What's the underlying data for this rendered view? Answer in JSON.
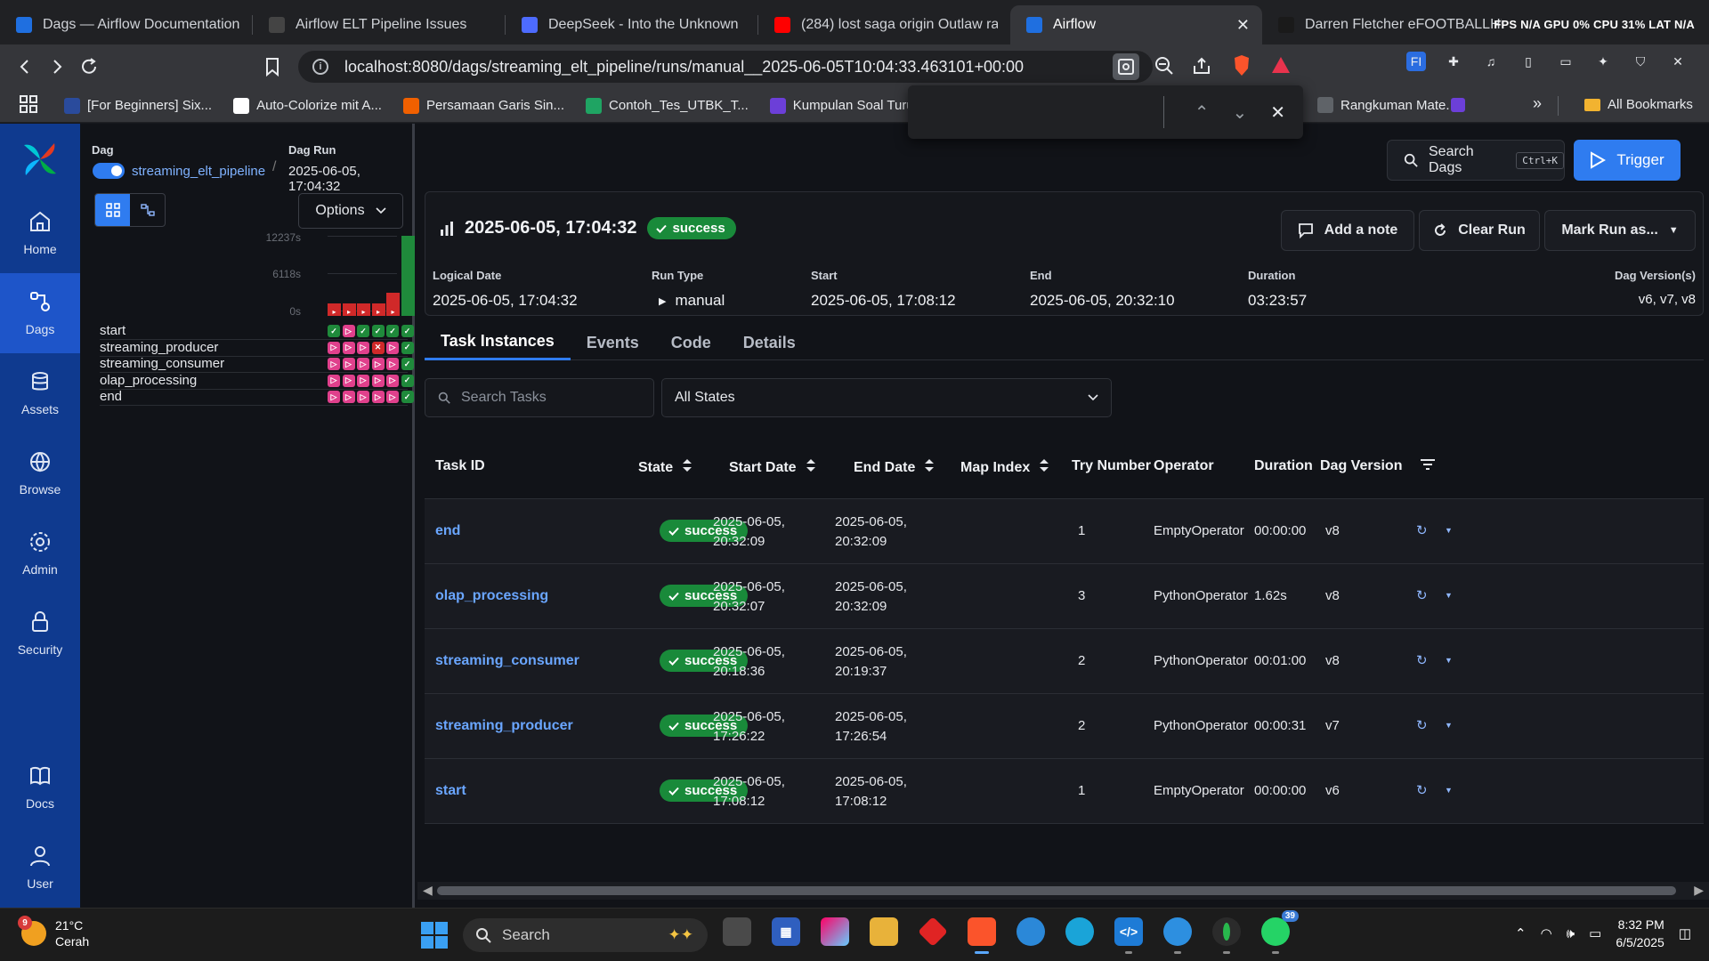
{
  "browser": {
    "tabs": [
      {
        "label": "Dags — Airflow Documentation",
        "fav_color": "#1f6fe0",
        "active": false
      },
      {
        "label": "Airflow ELT Pipeline Issues",
        "fav_color": "#444",
        "active": false
      },
      {
        "label": "DeepSeek - Into the Unknown",
        "fav_color": "#4d6bfe",
        "active": false
      },
      {
        "label": "(284) lost saga origin Outlaw ra",
        "fav_color": "#ff0000",
        "active": false
      },
      {
        "label": "Airflow",
        "fav_color": "#1f6fe0",
        "active": true
      },
      {
        "label": "Darren Fletcher eFOOTBALLHUB",
        "fav_color": "#1a1a1a",
        "active": false
      }
    ],
    "sys_stats": "FPS N/A GPU 0% CPU 31% LAT N/A",
    "url": "localhost:8080/dags/streaming_elt_pipeline/runs/manual__2025-06-05T10:04:33.463101+00:00",
    "bookmarks": [
      {
        "label": "[For Beginners] Six...",
        "color": "#2a4b9c"
      },
      {
        "label": "Auto-Colorize mit A...",
        "color": "#ffffff"
      },
      {
        "label": "Persamaan Garis Sin...",
        "color": "#f06000"
      },
      {
        "label": "Contoh_Tes_UTBK_T...",
        "color": "#1fa463"
      },
      {
        "label": "Kumpulan Soal Turu...",
        "color": "#6c3fd8"
      },
      {
        "label": "Rangkuman Mate...",
        "color": "#5f6368"
      }
    ],
    "all_bookmarks": "All Bookmarks"
  },
  "nav": {
    "items": [
      {
        "label": "Home",
        "icon": "home-icon",
        "active": false
      },
      {
        "label": "Dags",
        "icon": "dags-icon",
        "active": true
      },
      {
        "label": "Assets",
        "icon": "assets-icon",
        "active": false
      },
      {
        "label": "Browse",
        "icon": "browse-icon",
        "active": false
      },
      {
        "label": "Admin",
        "icon": "admin-icon",
        "active": false
      },
      {
        "label": "Security",
        "icon": "security-icon",
        "active": false
      }
    ],
    "bottom": [
      {
        "label": "Docs",
        "icon": "docs-icon"
      },
      {
        "label": "User",
        "icon": "user-icon"
      }
    ]
  },
  "breadcrumb": {
    "dag_label": "Dag",
    "dag_name": "streaming_elt_pipeline",
    "run_label": "Dag Run",
    "run_value": "2025-06-05, 17:04:32"
  },
  "grid": {
    "options_label": "Options",
    "axis_ticks": [
      "12237s",
      "6118s",
      "0s"
    ],
    "run_durations": [
      600,
      600,
      600,
      600,
      3600,
      12237
    ],
    "run_colors": [
      "#d02929",
      "#d02929",
      "#d02929",
      "#d02929",
      "#d02929",
      "#1f8a3b"
    ],
    "tasks": [
      {
        "name": "start",
        "cells": [
          "ok",
          "up",
          "ok",
          "ok",
          "ok",
          "ok"
        ]
      },
      {
        "name": "streaming_producer",
        "cells": [
          "up",
          "up",
          "up",
          "fail",
          "up",
          "ok"
        ]
      },
      {
        "name": "streaming_consumer",
        "cells": [
          "up",
          "up",
          "up",
          "up",
          "up",
          "ok"
        ]
      },
      {
        "name": "olap_processing",
        "cells": [
          "up",
          "up",
          "up",
          "up",
          "up",
          "ok"
        ]
      },
      {
        "name": "end",
        "cells": [
          "up",
          "up",
          "up",
          "up",
          "up",
          "ok"
        ]
      }
    ]
  },
  "header": {
    "search_label": "Search Dags",
    "search_shortcut": "Ctrl+K",
    "trigger_label": "Trigger"
  },
  "summary": {
    "title": "2025-06-05, 17:04:32",
    "state": "success",
    "add_note": "Add a note",
    "clear_run": "Clear Run",
    "mark_run": "Mark Run as...",
    "meta": [
      {
        "label": "Logical Date",
        "value": "2025-06-05, 17:04:32"
      },
      {
        "label": "Run Type",
        "value": "manual"
      },
      {
        "label": "Start",
        "value": "2025-06-05, 17:08:12"
      },
      {
        "label": "End",
        "value": "2025-06-05, 20:32:10"
      },
      {
        "label": "Duration",
        "value": "03:23:57"
      },
      {
        "label": "Dag Version(s)",
        "value": "v6, v7, v8"
      }
    ]
  },
  "tabs": [
    "Task Instances",
    "Events",
    "Code",
    "Details"
  ],
  "filters": {
    "search_placeholder": "Search Tasks",
    "state_value": "All States"
  },
  "table": {
    "columns": [
      "Task ID",
      "State",
      "Start Date",
      "End Date",
      "Map Index",
      "Try Number",
      "Operator",
      "Duration",
      "Dag Version"
    ],
    "rows": [
      {
        "task_id": "end",
        "state": "success",
        "start1": "2025-06-05,",
        "start2": "20:32:09",
        "end1": "2025-06-05,",
        "end2": "20:32:09",
        "map_index": "",
        "try_number": "1",
        "operator": "EmptyOperator",
        "duration": "00:00:00",
        "version": "v8"
      },
      {
        "task_id": "olap_processing",
        "state": "success",
        "start1": "2025-06-05,",
        "start2": "20:32:07",
        "end1": "2025-06-05,",
        "end2": "20:32:09",
        "map_index": "",
        "try_number": "3",
        "operator": "PythonOperator",
        "duration": "1.62s",
        "version": "v8"
      },
      {
        "task_id": "streaming_consumer",
        "state": "success",
        "start1": "2025-06-05,",
        "start2": "20:18:36",
        "end1": "2025-06-05,",
        "end2": "20:19:37",
        "map_index": "",
        "try_number": "2",
        "operator": "PythonOperator",
        "duration": "00:01:00",
        "version": "v8"
      },
      {
        "task_id": "streaming_producer",
        "state": "success",
        "start1": "2025-06-05,",
        "start2": "17:26:22",
        "end1": "2025-06-05,",
        "end2": "17:26:54",
        "map_index": "",
        "try_number": "2",
        "operator": "PythonOperator",
        "duration": "00:00:31",
        "version": "v7"
      },
      {
        "task_id": "start",
        "state": "success",
        "start1": "2025-06-05,",
        "start2": "17:08:12",
        "end1": "2025-06-05,",
        "end2": "17:08:12",
        "map_index": "",
        "try_number": "1",
        "operator": "EmptyOperator",
        "duration": "00:00:00",
        "version": "v6"
      }
    ]
  },
  "taskbar": {
    "weather_temp": "21°C",
    "weather_desc": "Cerah",
    "weather_badge": "9",
    "search_label": "Search",
    "time": "8:32 PM",
    "date": "6/5/2025",
    "whatsapp_badge": "39"
  }
}
